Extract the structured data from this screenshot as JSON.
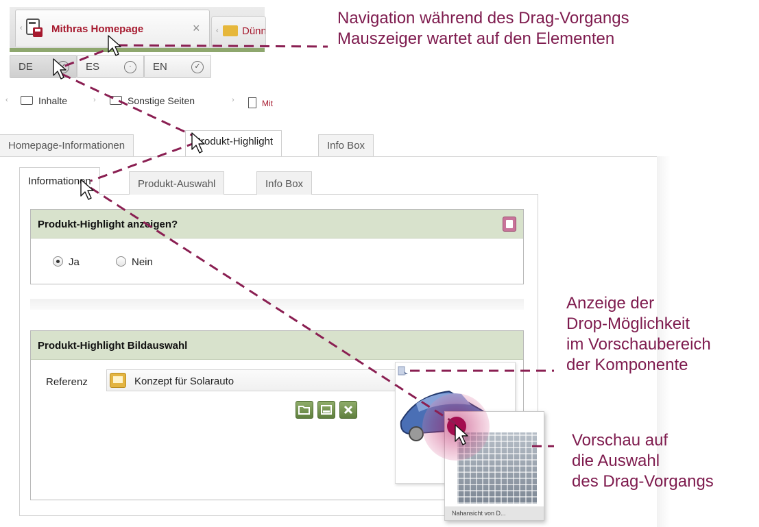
{
  "colors": {
    "accent_red": "#a6192e",
    "callout": "#7e1b4e",
    "section_head": "#d8e2cc",
    "tab_strip_line": "#8ea76e"
  },
  "doc_tabs": [
    {
      "label": "Mithras Homepage",
      "icon": "page-save-icon",
      "close": "×"
    },
    {
      "label": "Dünn",
      "icon": "folder-icon"
    }
  ],
  "languages": [
    {
      "code": "DE",
      "status": "check"
    },
    {
      "code": "ES",
      "status": "circle"
    },
    {
      "code": "EN",
      "status": "check"
    }
  ],
  "breadcrumb": {
    "items": [
      "Inhalte",
      "Sonstige Seiten",
      "Mit"
    ]
  },
  "main_tabs": [
    "Homepage-Informationen",
    "Produkt-Highlight",
    "Info Box"
  ],
  "sub_tabs": [
    "Informationen",
    "Produkt-Auswahl",
    "Info Box"
  ],
  "section1": {
    "title": "Produkt-Highlight anzeigen?",
    "options": [
      "Ja",
      "Nein"
    ],
    "selected": "Ja"
  },
  "section2": {
    "title": "Produkt-Highlight Bildauswahl",
    "ref_label": "Referenz",
    "ref_value": "Konzept für Solarauto"
  },
  "drag_preview": {
    "caption": "Nahansicht von D..."
  },
  "callouts": {
    "nav": [
      "Navigation während des Drag-Vorgangs",
      "Mauszeiger wartet auf den Elementen"
    ],
    "drop": [
      "Anzeige der",
      "Drop-Möglichkeit",
      "im Vorschaubereich",
      "der Komponente"
    ],
    "preview": [
      "Vorschau auf",
      "die Auswahl",
      "des Drag-Vorgangs"
    ]
  }
}
